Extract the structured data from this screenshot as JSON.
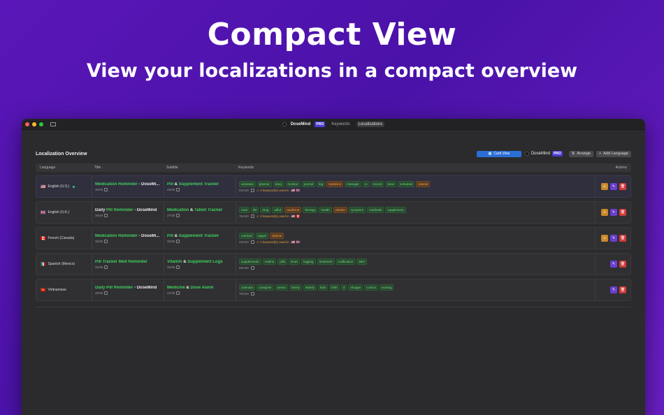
{
  "hero": {
    "title": "Compact View",
    "subtitle": "View your localizations in a compact overview"
  },
  "titlebar": {
    "app_name": "DoseMind",
    "pro_badge": "PRO",
    "tabs": [
      "Keywords",
      "Localizations"
    ],
    "active_tab": "Localizations"
  },
  "toolbar": {
    "title": "Localization Overview",
    "card_view_label": "Card View",
    "app_name": "DoseMind",
    "pro_badge": "PRO",
    "arrange_label": "Arrange",
    "add_language_label": "Add Language"
  },
  "columns": {
    "language": "Language",
    "title": "Title",
    "subtitle": "Subtitle",
    "keywords": "Keywords",
    "actions": "Actions"
  },
  "rows": [
    {
      "flag": "🇺🇸",
      "language": "English (U.S.)",
      "live": true,
      "title_parts": [
        {
          "t": "Medication Reminder",
          "c": "g"
        },
        {
          "t": " - DoseMi...",
          "c": "w"
        }
      ],
      "title_count": "30/30",
      "subtitle_parts": [
        {
          "t": "Pill",
          "c": "g"
        },
        {
          "t": " & ",
          "c": "w"
        },
        {
          "t": "Supplement Tracker",
          "c": "g"
        }
      ],
      "subtitle_count": "25/30",
      "keywords": [
        {
          "k": "assistant"
        },
        {
          "k": "planner"
        },
        {
          "k": "diary"
        },
        {
          "k": "monitor"
        },
        {
          "k": "journal"
        },
        {
          "k": "log"
        },
        {
          "k": "medicine",
          "warn": true
        },
        {
          "k": "manager"
        },
        {
          "k": "rx"
        },
        {
          "k": "record"
        },
        {
          "k": "dose"
        },
        {
          "k": "schedule"
        },
        {
          "k": "vitamin",
          "warn": true
        }
      ],
      "kw_count": "92/100",
      "kw_warning": "2 keyword(s) used in",
      "kw_flags": "🇺🇸 🇬🇧",
      "has_warn_action": true
    },
    {
      "flag": "🇬🇧",
      "language": "English (U.K.)",
      "live": false,
      "title_parts": [
        {
          "t": "Daily ",
          "c": "w"
        },
        {
          "t": "Pill Reminder",
          "c": "g"
        },
        {
          "t": " - DoseMind",
          "c": "w"
        }
      ],
      "title_count": "30/30",
      "subtitle_parts": [
        {
          "t": "Medication",
          "c": "g"
        },
        {
          "t": " & ",
          "c": "w"
        },
        {
          "t": "Tablet Tracker",
          "c": "g"
        }
      ],
      "subtitle_count": "27/30",
      "keywords": [
        {
          "k": "med"
        },
        {
          "k": "list"
        },
        {
          "k": "drug"
        },
        {
          "k": "adhd"
        },
        {
          "k": "medicine",
          "warn": true
        },
        {
          "k": "therapy"
        },
        {
          "k": "health"
        },
        {
          "k": "vitamin",
          "warn": true
        },
        {
          "k": "symptom"
        },
        {
          "k": "medisafe"
        },
        {
          "k": "supplement"
        }
      ],
      "kw_count": "76/100",
      "kw_warning": "2 keyword(s) used in",
      "kw_flags": "🇺🇸 🇨🇦",
      "has_warn_action": true
    },
    {
      "flag": "🇨🇦",
      "language": "French (Canada)",
      "live": false,
      "title_parts": [
        {
          "t": "Medication Reminder",
          "c": "g"
        },
        {
          "t": " - DoseMi...",
          "c": "w"
        }
      ],
      "title_count": "30/30",
      "subtitle_parts": [
        {
          "t": "Pill",
          "c": "g"
        },
        {
          "t": " & ",
          "c": "w"
        },
        {
          "t": "Supplement Tracker",
          "c": "g"
        }
      ],
      "subtitle_count": "25/30",
      "keywords": [
        {
          "k": "medical"
        },
        {
          "k": "rappel"
        },
        {
          "k": "vitamin",
          "warn": true
        }
      ],
      "kw_count": "22/100",
      "kw_warning": "1 keyword(s) used in",
      "kw_flags": "🇺🇸 🇬🇧",
      "has_warn_action": true
    },
    {
      "flag": "🇲🇽",
      "language": "Spanish (Mexico)",
      "live": false,
      "title_parts": [
        {
          "t": "Pill Tracker Med Reminder",
          "c": "g"
        }
      ],
      "title_count": "25/30",
      "subtitle_parts": [
        {
          "t": "Vitamin",
          "c": "g"
        },
        {
          "t": " & ",
          "c": "w"
        },
        {
          "t": "Supplement Logs",
          "c": "g"
        }
      ],
      "subtitle_count": "25/30",
      "keywords": [
        {
          "k": "supplements"
        },
        {
          "k": "routine"
        },
        {
          "k": "pills"
        },
        {
          "k": "timer"
        },
        {
          "k": "logging"
        },
        {
          "k": "treatment"
        },
        {
          "k": "notification"
        },
        {
          "k": "alert"
        }
      ],
      "kw_count": "68/100",
      "kw_warning": "",
      "kw_flags": "",
      "has_warn_action": false
    },
    {
      "flag": "🇻🇳",
      "language": "Vietnamese",
      "live": false,
      "title_parts": [
        {
          "t": "Daily Pill Reminder",
          "c": "g"
        },
        {
          "t": " - DoseMind",
          "c": "w"
        }
      ],
      "title_count": "30/30",
      "subtitle_parts": [
        {
          "t": "Medicine",
          "c": "g"
        },
        {
          "t": " & ",
          "c": "w"
        },
        {
          "t": "Dose Alarm",
          "c": "g"
        }
      ],
      "subtitle_count": "21/30",
      "keywords": [
        {
          "k": "calendar"
        },
        {
          "k": "caregiver"
        },
        {
          "k": "senior"
        },
        {
          "k": "family"
        },
        {
          "k": "elderly"
        },
        {
          "k": "kids"
        },
        {
          "k": "birth"
        },
        {
          "k": "d"
        },
        {
          "k": "shoppe"
        },
        {
          "k": "control"
        },
        {
          "k": "nursing"
        }
      ],
      "kw_count": "76/100",
      "kw_warning": "",
      "kw_flags": "",
      "has_warn_action": false
    }
  ],
  "colors": {
    "accent": "#2a6fd8",
    "ok": "#3fcf5c",
    "warn": "#e6a23c",
    "danger": "#d23c3c",
    "edit": "#6a3fd0"
  }
}
